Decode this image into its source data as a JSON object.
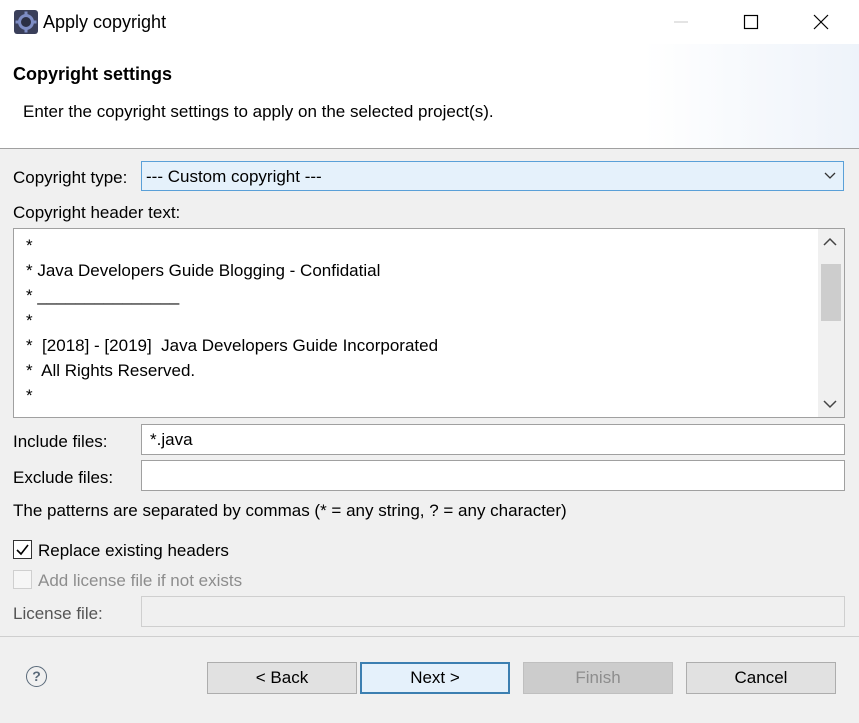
{
  "window": {
    "title": "Apply copyright"
  },
  "banner": {
    "title": "Copyright settings",
    "description": "Enter the copyright settings to apply on the selected project(s)."
  },
  "form": {
    "copyright_type_label": "Copyright type:",
    "copyright_type_value": "--- Custom copyright ---",
    "header_text_label": "Copyright header text:",
    "header_lines": [
      "*",
      "* Java Developers Guide Blogging - Confidatial",
      "* _______________",
      "*",
      "*  [2018] - [2019]  Java Developers Guide Incorporated",
      "*  All Rights Reserved.",
      "*"
    ],
    "include_label": "Include files:",
    "include_value": "*.java",
    "exclude_label": "Exclude files:",
    "exclude_value": "",
    "patterns_hint": "The patterns are separated by commas (* = any string, ? = any character)",
    "replace_headers_label": "Replace existing headers",
    "replace_headers_checked": true,
    "add_license_label": "Add license file if not exists",
    "add_license_checked": false,
    "license_file_label": "License file:",
    "license_file_value": ""
  },
  "buttons": {
    "help_glyph": "?",
    "back": "< Back",
    "next": "Next >",
    "finish": "Finish",
    "cancel": "Cancel"
  },
  "icons": {
    "app": "eclipse-gear-icon",
    "minimize": "minimize-icon",
    "maximize": "maximize-icon",
    "close": "close-icon",
    "dropdown": "chevron-down-icon",
    "scroll_up": "chevron-up-icon",
    "scroll_down": "chevron-down-icon",
    "check": "checkmark-icon",
    "help": "help-icon"
  },
  "colors": {
    "accent": "#3c7fb1",
    "combo_bg": "#e5f1fb",
    "disabled_text": "#8d8d8d"
  }
}
